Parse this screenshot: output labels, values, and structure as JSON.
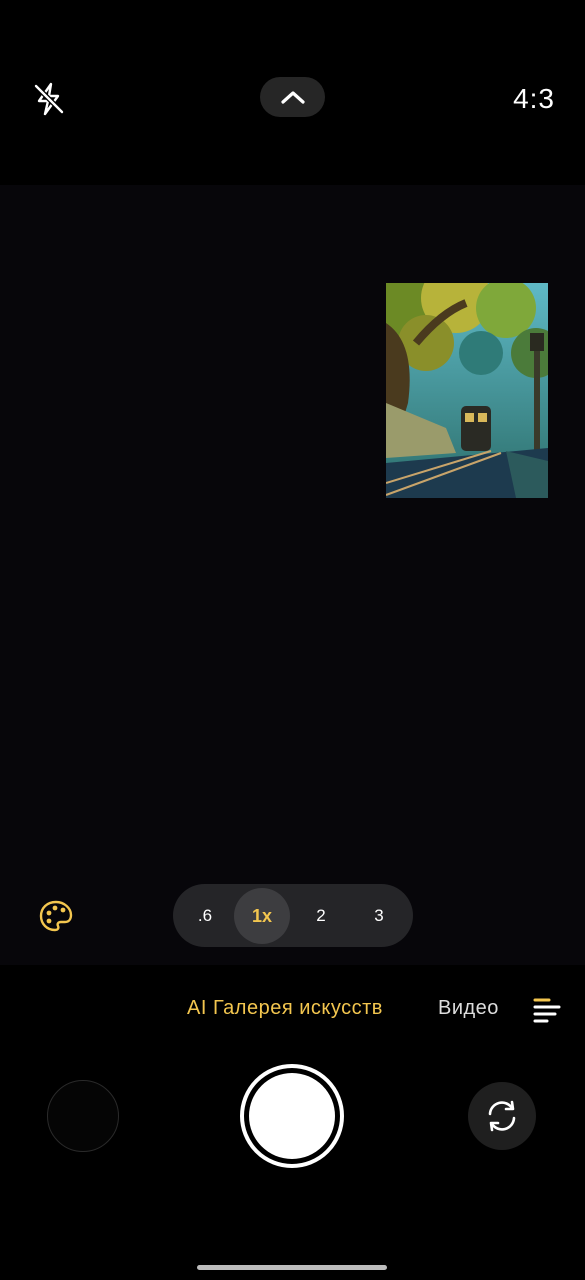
{
  "topbar": {
    "flash_icon": "flash-off-icon",
    "expand_icon": "chevron-up-icon",
    "aspect_ratio": "4:3"
  },
  "viewfinder": {
    "preview_image": "anime-forest-train-scene",
    "filter_icon": "palette-icon"
  },
  "zoom": {
    "options": [
      ".6",
      "1x",
      "2",
      "3"
    ],
    "selected": "1x"
  },
  "modes": {
    "active": "AI Галерея искусств",
    "next": "Видео",
    "menu_icon": "more-modes-icon"
  },
  "controls": {
    "gallery_icon": "gallery-thumbnail",
    "shutter_icon": "shutter-button",
    "switch_icon": "switch-camera-icon"
  },
  "colors": {
    "accent": "#f3c64f",
    "background": "#000000",
    "pill": "#252528"
  }
}
